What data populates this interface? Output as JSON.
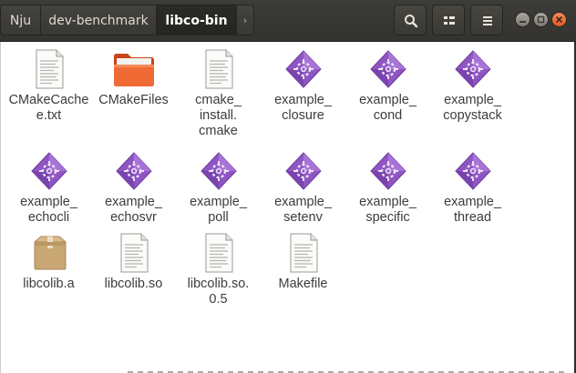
{
  "breadcrumbs": [
    "Nju",
    "dev-benchmark",
    "libco-bin"
  ],
  "nav_arrow": "›",
  "toolbar": {
    "search_icon": "search-icon",
    "view_icon": "grid-view-icon",
    "menu_icon": "hamburger-menu-icon"
  },
  "window_controls": [
    "minimize",
    "maximize",
    "close"
  ],
  "colors": {
    "headerbar": "#3d3c38",
    "close_button": "#e95420",
    "executable_icon": "#8b4fbf",
    "folder_icon": "#e8551d"
  },
  "files": [
    {
      "name": "CMakeCache\ne.txt",
      "type": "text"
    },
    {
      "name": "CMakeFiles",
      "type": "folder"
    },
    {
      "name": "cmake_\ninstall.\ncmake",
      "type": "text"
    },
    {
      "name": "example_\nclosure",
      "type": "executable"
    },
    {
      "name": "example_\ncond",
      "type": "executable"
    },
    {
      "name": "example_\ncopystack",
      "type": "executable"
    },
    {
      "name": "example_\nechocli",
      "type": "executable"
    },
    {
      "name": "example_\nechosvr",
      "type": "executable"
    },
    {
      "name": "example_\npoll",
      "type": "executable"
    },
    {
      "name": "example_\nsetenv",
      "type": "executable"
    },
    {
      "name": "example_\nspecific",
      "type": "executable"
    },
    {
      "name": "example_\nthread",
      "type": "executable"
    },
    {
      "name": "libcolib.a",
      "type": "archive"
    },
    {
      "name": "libcolib.so",
      "type": "text"
    },
    {
      "name": "libcolib.so.\n0.5",
      "type": "text"
    },
    {
      "name": "Makefile",
      "type": "text"
    }
  ]
}
